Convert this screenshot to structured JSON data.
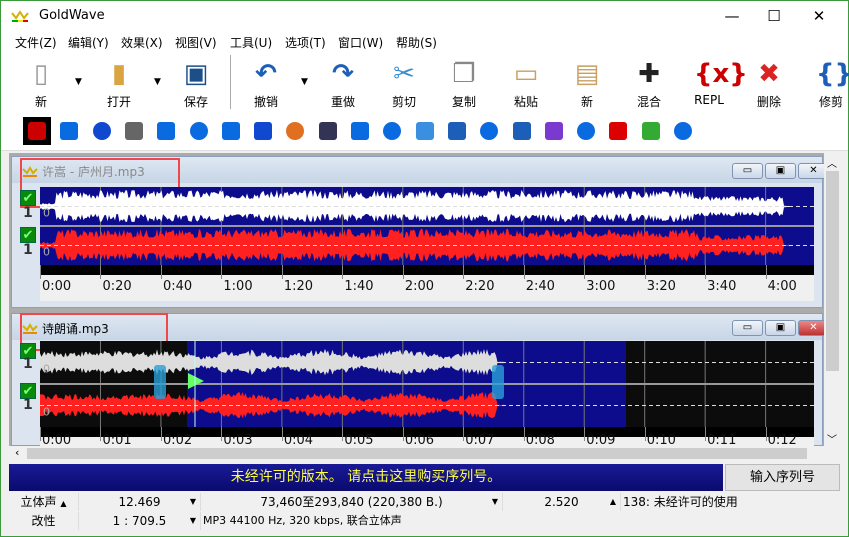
{
  "app": {
    "title": "GoldWave",
    "minimize": "—",
    "maximize": "☐",
    "close": "✕"
  },
  "menu": [
    "文件(Z)",
    "编辑(Y)",
    "效果(X)",
    "视图(V)",
    "工具(U)",
    "选项(T)",
    "窗口(W)",
    "帮助(S)"
  ],
  "toolbar": [
    {
      "label": "新",
      "icon": "new-file-icon"
    },
    {
      "label": "打开",
      "icon": "open-folder-icon"
    },
    {
      "label": "保存",
      "icon": "save-disk-icon"
    },
    {
      "label": "撤销",
      "icon": "undo-icon"
    },
    {
      "label": "重做",
      "icon": "redo-icon"
    },
    {
      "label": "剪切",
      "icon": "scissors-icon"
    },
    {
      "label": "复制",
      "icon": "copy-icon"
    },
    {
      "label": "粘贴",
      "icon": "paste-icon"
    },
    {
      "label": "新",
      "icon": "paste-new-icon"
    },
    {
      "label": "混合",
      "icon": "mix-icon"
    },
    {
      "label": "REPL",
      "icon": "replace-icon"
    },
    {
      "label": "删除",
      "icon": "delete-icon"
    },
    {
      "label": "修剪",
      "icon": "trim-icon"
    }
  ],
  "effects_toolbar": [
    "stop-icon",
    "dynamics-icon",
    "echo-icon",
    "mechanize-icon",
    "doppler-icon",
    "flanger-icon",
    "reverse-icon",
    "compressor-icon",
    "filter-icon",
    "pitch-icon",
    "pan-icon",
    "offset-icon",
    "volume-icon",
    "equalizer-icon",
    "spectrum-icon",
    "time-warp-icon",
    "noise-reduction-icon",
    "pop-click-icon",
    "clip-icon",
    "spectrum-filter-icon",
    "speaker-icon"
  ],
  "documents": [
    {
      "title": "许嵩 - 庐州月.mp3",
      "channel_labels": [
        "1",
        "1"
      ],
      "zero": "0",
      "time_labels": [
        "0:00",
        "0:20",
        "0:40",
        "1:00",
        "1:20",
        "1:40",
        "2:00",
        "2:20",
        "2:40",
        "3:00",
        "3:20",
        "3:40",
        "4:00"
      ],
      "active": false
    },
    {
      "title": "诗朗诵.mp3",
      "channel_labels": [
        "1",
        "1"
      ],
      "zero": "0",
      "time_labels": [
        "0:00",
        "0:01",
        "0:02",
        "0:03",
        "0:04",
        "0:05",
        "0:06",
        "0:07",
        "0:08",
        "0:09",
        "0:10",
        "0:11",
        "0:12"
      ],
      "active": true
    }
  ],
  "banner": {
    "text": "未经许可的版本。 请点击这里购买序列号。",
    "button": "输入序列号"
  },
  "status": {
    "row1": {
      "channels": "立体声",
      "length": "12.469",
      "selection": "73,460至293,840 (220,380 B.)",
      "position": "2.520",
      "message": "138: 未经许可的使用"
    },
    "row2": {
      "state": "改性",
      "zoom": "1 : 709.5",
      "format": "MP3 44100 Hz, 320 kbps, 联合立体声"
    }
  },
  "colors": {
    "wave_bg": "#0c0c8c",
    "left_channel": "#ffffff",
    "right_channel": "#ff2020",
    "banner_text": "#ffff40",
    "highlight_box": "#f04848"
  }
}
